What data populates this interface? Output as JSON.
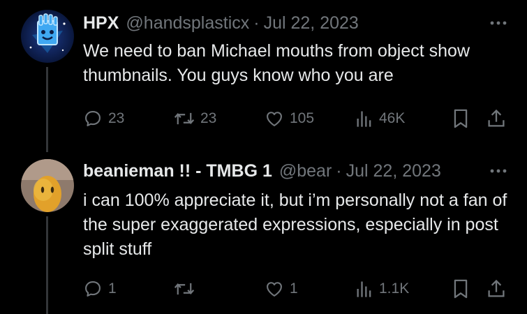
{
  "tweets": [
    {
      "display_name": "HPX",
      "handle": "@handsplasticx",
      "separator": "·",
      "date": "Jul 22, 2023",
      "text": "We need to ban Michael mouths from object show thumbnails. You guys know who you are",
      "replies": "23",
      "retweets": "23",
      "likes": "105",
      "views": "46K",
      "avatar_icon": "blue-hand-character-avatar"
    },
    {
      "display_name": "beanieman !! - TMBG 1",
      "handle": "@bear",
      "separator": "·",
      "date": "Jul 22, 2023",
      "text": "i can 100% appreciate it, but i’m personally not a fan of the super exaggerated expressions, especially in post split stuff",
      "replies": "1",
      "retweets": "",
      "likes": "1",
      "views": "1.1K",
      "avatar_icon": "bean-character-avatar"
    }
  ],
  "icons": {
    "reply": "speech-bubble-icon",
    "retweet": "retweet-arrows-icon",
    "like": "heart-icon",
    "views": "bar-chart-icon",
    "bookmark": "bookmark-icon",
    "share": "share-upload-icon",
    "more": "more-dots-icon"
  },
  "colors": {
    "background": "#000000",
    "primary_text": "#e7e9ea",
    "secondary_text": "#71767b",
    "thread_line": "#333639"
  }
}
